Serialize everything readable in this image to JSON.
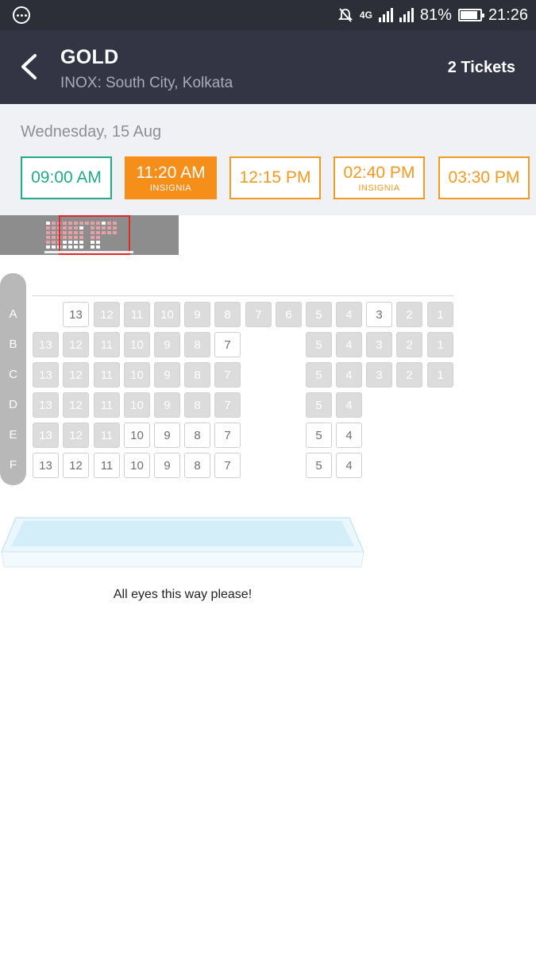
{
  "status_bar": {
    "network_label": "4G",
    "battery_text": "81%",
    "time": "21:26",
    "icons": [
      "notification-icon",
      "mute-icon",
      "signal-icon",
      "battery-icon"
    ]
  },
  "header": {
    "title": "GOLD",
    "subtitle": "INOX: South City, Kolkata",
    "tickets": "2 Tickets",
    "back_icon": "back-arrow-icon"
  },
  "schedule": {
    "date": "Wednesday, 15 Aug",
    "showtimes": [
      {
        "time": "09:00 AM",
        "tag": "",
        "state": "green"
      },
      {
        "time": "11:20 AM",
        "tag": "INSIGNIA",
        "state": "active"
      },
      {
        "time": "12:15 PM",
        "tag": "",
        "state": "default"
      },
      {
        "time": "02:40 PM",
        "tag": "INSIGNIA",
        "state": "default"
      },
      {
        "time": "03:30 PM",
        "tag": "",
        "state": "default"
      }
    ]
  },
  "seat_map": {
    "rows": [
      {
        "label": "A",
        "seats": [
          {
            "n": "13",
            "s": "av"
          },
          {
            "n": "12",
            "s": "un"
          },
          {
            "n": "11",
            "s": "un"
          },
          {
            "n": "10",
            "s": "un"
          },
          {
            "n": "9",
            "s": "un"
          },
          {
            "n": "8",
            "s": "un"
          },
          {
            "n": "7",
            "s": "un"
          },
          {
            "n": "6",
            "s": "un"
          },
          {
            "n": "5",
            "s": "un"
          },
          {
            "n": "4",
            "s": "un"
          },
          {
            "n": "3",
            "s": "av"
          },
          {
            "n": "2",
            "s": "un"
          },
          {
            "n": "1",
            "s": "un"
          }
        ]
      },
      {
        "label": "B",
        "seats": [
          {
            "n": "13",
            "s": "un"
          },
          {
            "n": "12",
            "s": "un"
          },
          {
            "n": "11",
            "s": "un"
          },
          {
            "n": "10",
            "s": "un"
          },
          {
            "n": "9",
            "s": "un"
          },
          {
            "n": "8",
            "s": "un"
          },
          {
            "n": "7",
            "s": "av"
          },
          {
            "n": "5",
            "s": "un"
          },
          {
            "n": "4",
            "s": "un"
          },
          {
            "n": "3",
            "s": "un"
          },
          {
            "n": "2",
            "s": "un"
          },
          {
            "n": "1",
            "s": "un"
          }
        ]
      },
      {
        "label": "C",
        "seats": [
          {
            "n": "13",
            "s": "un"
          },
          {
            "n": "12",
            "s": "un"
          },
          {
            "n": "11",
            "s": "un"
          },
          {
            "n": "10",
            "s": "un"
          },
          {
            "n": "9",
            "s": "un"
          },
          {
            "n": "8",
            "s": "un"
          },
          {
            "n": "7",
            "s": "un"
          },
          {
            "n": "5",
            "s": "un"
          },
          {
            "n": "4",
            "s": "un"
          },
          {
            "n": "3",
            "s": "un"
          },
          {
            "n": "2",
            "s": "un"
          },
          {
            "n": "1",
            "s": "un"
          }
        ]
      },
      {
        "label": "D",
        "seats": [
          {
            "n": "13",
            "s": "un"
          },
          {
            "n": "12",
            "s": "un"
          },
          {
            "n": "11",
            "s": "un"
          },
          {
            "n": "10",
            "s": "un"
          },
          {
            "n": "9",
            "s": "un"
          },
          {
            "n": "8",
            "s": "un"
          },
          {
            "n": "7",
            "s": "un"
          },
          {
            "n": "5",
            "s": "un"
          },
          {
            "n": "4",
            "s": "un"
          }
        ]
      },
      {
        "label": "E",
        "seats": [
          {
            "n": "13",
            "s": "un"
          },
          {
            "n": "12",
            "s": "un"
          },
          {
            "n": "11",
            "s": "un"
          },
          {
            "n": "10",
            "s": "av"
          },
          {
            "n": "9",
            "s": "av"
          },
          {
            "n": "8",
            "s": "av"
          },
          {
            "n": "7",
            "s": "av"
          },
          {
            "n": "5",
            "s": "av"
          },
          {
            "n": "4",
            "s": "av"
          }
        ]
      },
      {
        "label": "F",
        "seats": [
          {
            "n": "13",
            "s": "av"
          },
          {
            "n": "12",
            "s": "av"
          },
          {
            "n": "11",
            "s": "av"
          },
          {
            "n": "10",
            "s": "av"
          },
          {
            "n": "9",
            "s": "av"
          },
          {
            "n": "8",
            "s": "av"
          },
          {
            "n": "7",
            "s": "av"
          },
          {
            "n": "5",
            "s": "av"
          },
          {
            "n": "4",
            "s": "av"
          }
        ]
      }
    ]
  },
  "screen": {
    "caption": "All eyes this way please!"
  }
}
